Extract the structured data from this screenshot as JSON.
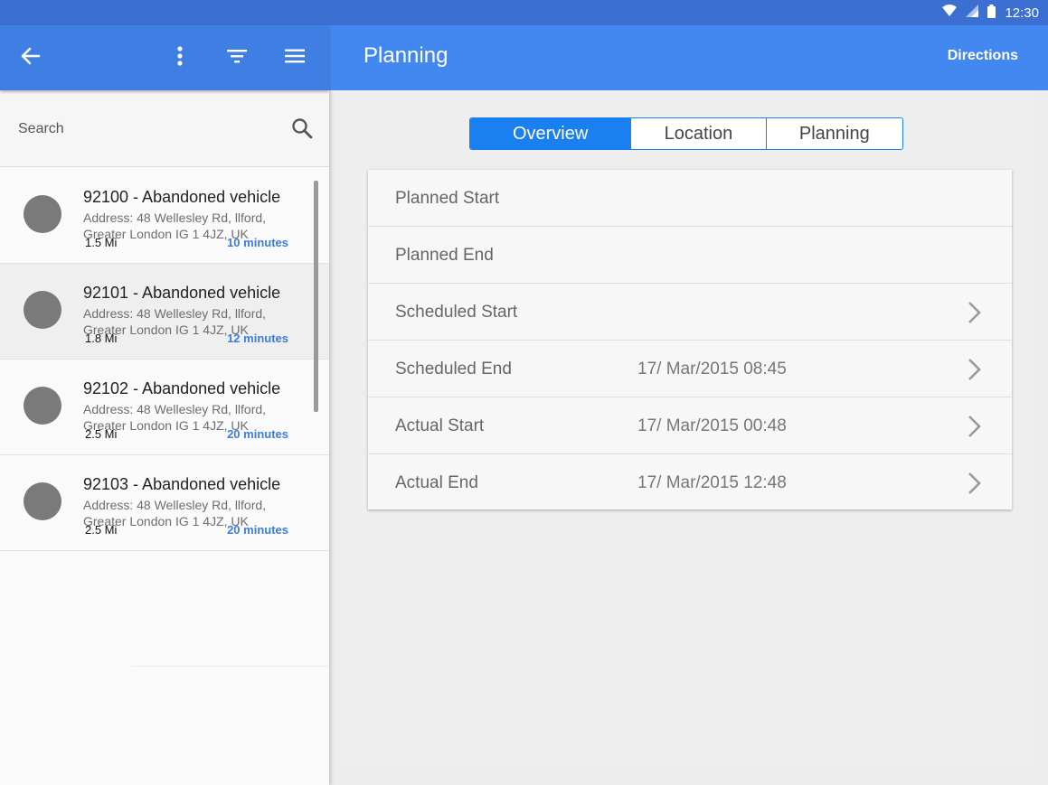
{
  "status_bar": {
    "time": "12:30"
  },
  "left_header": {},
  "right_header": {
    "title": "Planning",
    "directions_label": "Directions"
  },
  "search": {
    "placeholder": "Search"
  },
  "list": [
    {
      "title": "92100 - Abandoned vehicle",
      "address": "Address: 48 Wellesley Rd, llford, Greater London IG 1 4JZ, UK",
      "distance": "1.5 Mi",
      "time": "10 minutes"
    },
    {
      "title": "92101 - Abandoned vehicle",
      "address": "Address: 48 Wellesley Rd, llford, Greater London IG 1 4JZ, UK",
      "distance": "1.8 Mi",
      "time": "12 minutes"
    },
    {
      "title": "92102 - Abandoned vehicle",
      "address": "Address: 48 Wellesley Rd, llford, Greater London IG 1 4JZ, UK",
      "distance": "2.5 Mi",
      "time": "20 minutes"
    },
    {
      "title": "92103 - Abandoned vehicle",
      "address": "Address: 48 Wellesley Rd, llford, Greater London IG 1 4JZ, UK",
      "distance": "2.5 Mi",
      "time": "20 minutes"
    }
  ],
  "tabs": [
    {
      "label": "Overview",
      "active": true
    },
    {
      "label": "Location",
      "active": false
    },
    {
      "label": "Planning",
      "active": false
    }
  ],
  "details": [
    {
      "label": "Planned Start",
      "value": "",
      "has_chevron": false
    },
    {
      "label": "Planned End",
      "value": "",
      "has_chevron": false
    },
    {
      "label": "Scheduled Start",
      "value": "",
      "has_chevron": true
    },
    {
      "label": "Scheduled End",
      "value": "17/ Mar/2015 08:45",
      "has_chevron": true
    },
    {
      "label": "Actual Start",
      "value": "17/ Mar/2015 00:48",
      "has_chevron": true
    },
    {
      "label": "Actual End",
      "value": "17/ Mar/2015 12:48",
      "has_chevron": true
    }
  ],
  "colors": {
    "status_bar": "#3b6fd1",
    "left_app_bar": "#3f7ee2",
    "right_app_bar": "#4388f0",
    "accent": "#1a7ff0",
    "time_text": "#3a7de0"
  },
  "icons": [
    "wifi-icon",
    "signal-icon",
    "battery-icon",
    "back-arrow-icon",
    "more-vert-icon",
    "filter-icon",
    "menu-icon",
    "search-icon",
    "chevron-right-icon"
  ]
}
